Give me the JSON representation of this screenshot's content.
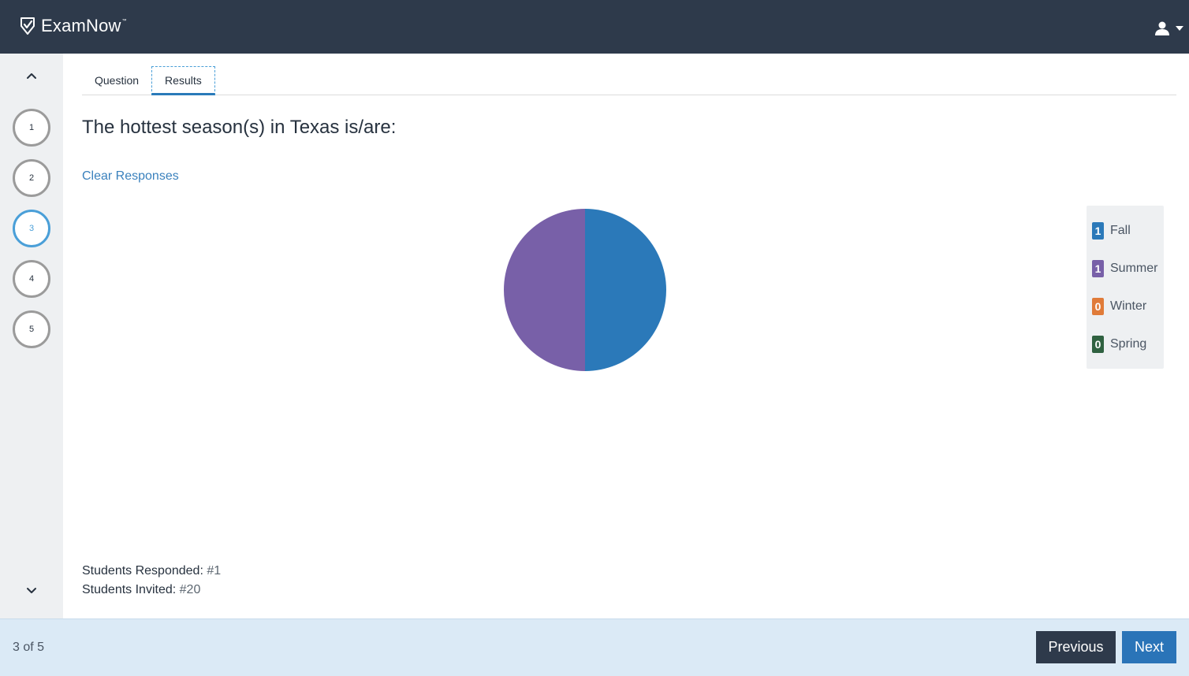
{
  "header": {
    "brand_name": "ExamNow",
    "brand_tm": "™",
    "colors": {
      "background": "#2e3a4b"
    }
  },
  "sidebar": {
    "questions": [
      {
        "number": "1",
        "active": false
      },
      {
        "number": "2",
        "active": false
      },
      {
        "number": "3",
        "active": true
      },
      {
        "number": "4",
        "active": false
      },
      {
        "number": "5",
        "active": false
      }
    ],
    "up_icon": "chevron-up-icon",
    "down_icon": "chevron-down-icon"
  },
  "tabs": [
    {
      "label": "Question",
      "active": false
    },
    {
      "label": "Results",
      "active": true
    }
  ],
  "question": {
    "text": "The hottest season(s) in Texas is/are:"
  },
  "actions": {
    "clear_responses": "Clear Responses"
  },
  "chart_data": {
    "type": "pie",
    "title": "",
    "slices": [
      {
        "label": "Fall",
        "value": 1,
        "color": "#2b79b9"
      },
      {
        "label": "Summer",
        "value": 1,
        "color": "#7860a8"
      },
      {
        "label": "Winter",
        "value": 0,
        "color": "#e07b39"
      },
      {
        "label": "Spring",
        "value": 0,
        "color": "#2f6140"
      }
    ],
    "legend_position": "right"
  },
  "legend": [
    {
      "count": "1",
      "label": "Fall",
      "color": "#2b79b9"
    },
    {
      "count": "1",
      "label": "Summer",
      "color": "#7860a8"
    },
    {
      "count": "0",
      "label": "Winter",
      "color": "#e07b39"
    },
    {
      "count": "0",
      "label": "Spring",
      "color": "#2f6140"
    }
  ],
  "stats": {
    "responded_label": "Students Responded:",
    "responded_value": "#1",
    "invited_label": "Students Invited:",
    "invited_value": "#20"
  },
  "footer": {
    "page_indicator": "3 of 5",
    "previous_label": "Previous",
    "next_label": "Next"
  }
}
